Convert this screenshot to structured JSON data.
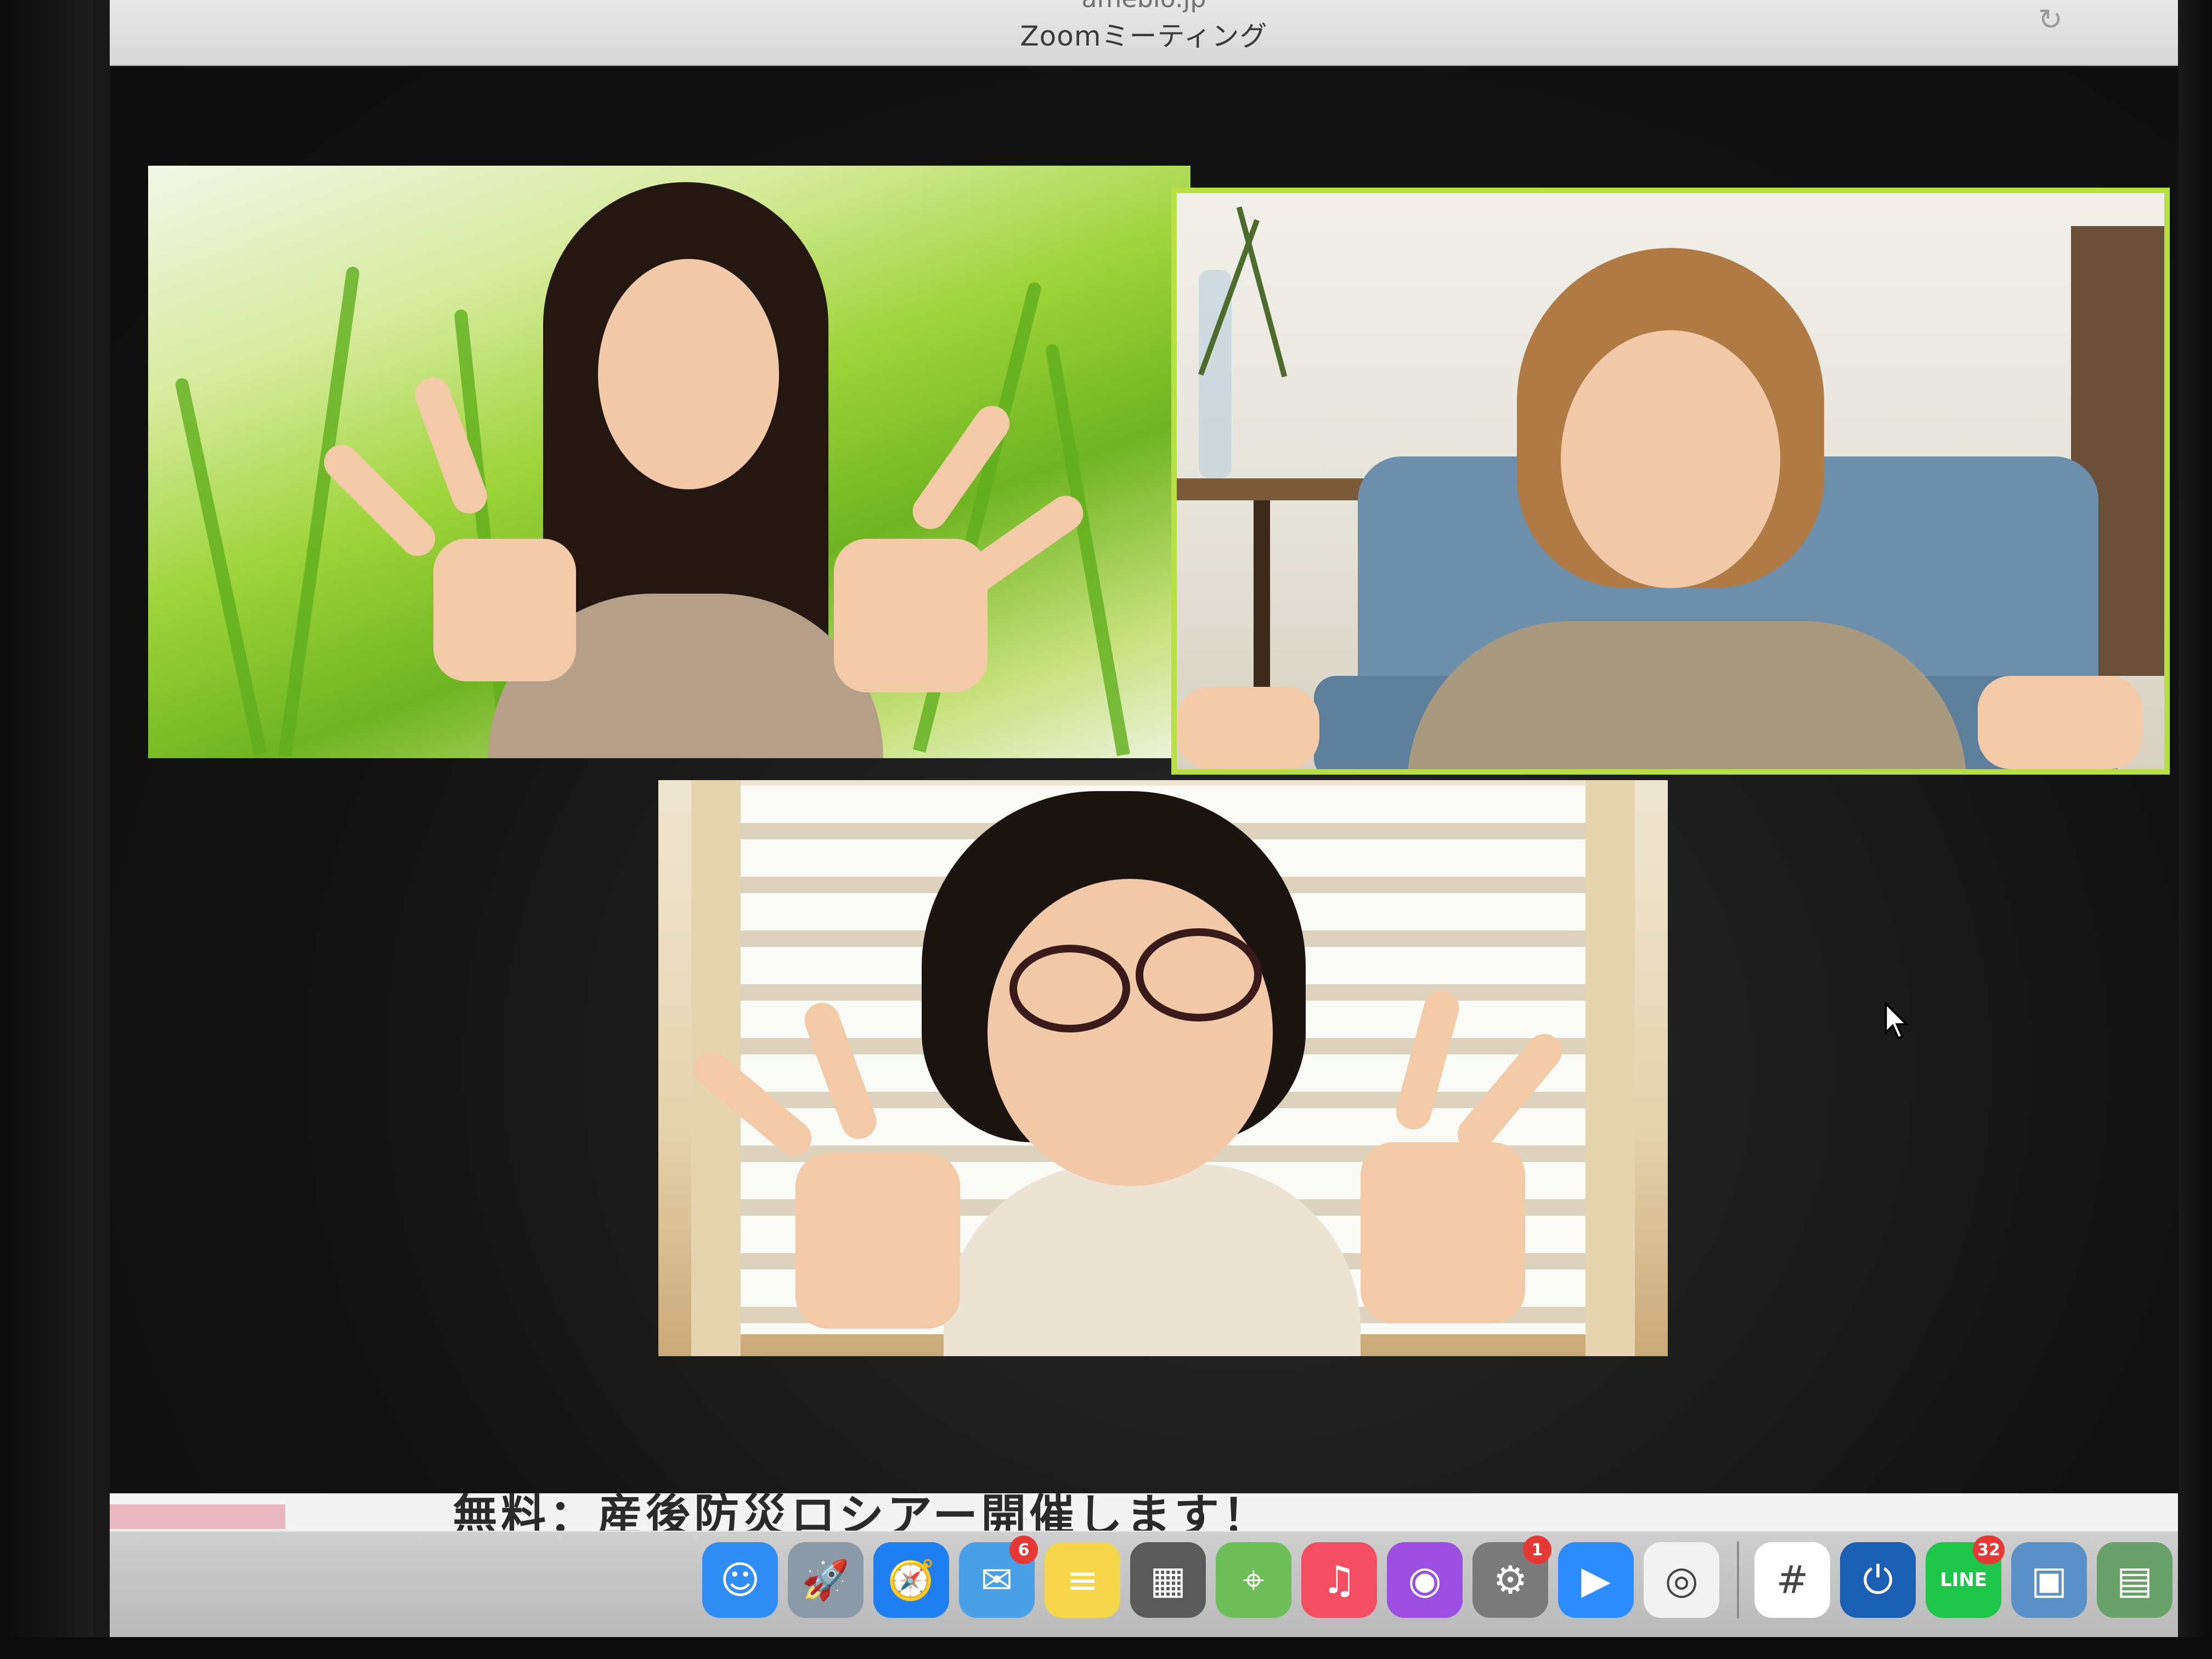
{
  "window": {
    "url": "ameblo.jp",
    "title": "Zoomミーティング"
  },
  "background_page": {
    "text": "無料：産後防災ロシアー開催します！"
  },
  "dock": {
    "items": [
      {
        "name": "Finder",
        "icon": "finder-icon",
        "color": "#2f8df3"
      },
      {
        "name": "Launchpad",
        "icon": "rocket-icon",
        "color": "#8c9aa8"
      },
      {
        "name": "Safari",
        "icon": "compass-icon",
        "color": "#1f7ff0"
      },
      {
        "name": "Mail",
        "icon": "mail-icon",
        "color": "#4aa0e6",
        "badge": "6"
      },
      {
        "name": "Notes",
        "icon": "notes-icon",
        "color": "#f5d64a"
      },
      {
        "name": "Calculator",
        "icon": "calculator-icon",
        "color": "#5a5a5a"
      },
      {
        "name": "Maps",
        "icon": "map-icon",
        "color": "#6dbd59"
      },
      {
        "name": "Music",
        "icon": "music-icon",
        "color": "#f34d62"
      },
      {
        "name": "Podcasts",
        "icon": "podcast-icon",
        "color": "#9b4ee0"
      },
      {
        "name": "System Preferences",
        "icon": "gear-icon",
        "color": "#7a7a7a",
        "badge": "1"
      },
      {
        "name": "Zoom",
        "icon": "video-camera-icon",
        "color": "#2d8cff"
      },
      {
        "name": "Chrome",
        "icon": "chrome-icon",
        "color": "#f2f2f2"
      },
      {
        "name": "Slack",
        "icon": "slack-icon",
        "color": "#ffffff"
      },
      {
        "name": "Plug App",
        "icon": "plug-icon",
        "color": "#1a5fb4"
      },
      {
        "name": "LINE",
        "icon": "line-icon",
        "color": "#1fc44a",
        "badge": "32",
        "label": "LINE"
      },
      {
        "name": "Preview",
        "icon": "preview-icon",
        "color": "#5b8fc7"
      },
      {
        "name": "Downloads",
        "icon": "folder-icon",
        "color": "#6aa06a"
      }
    ]
  }
}
